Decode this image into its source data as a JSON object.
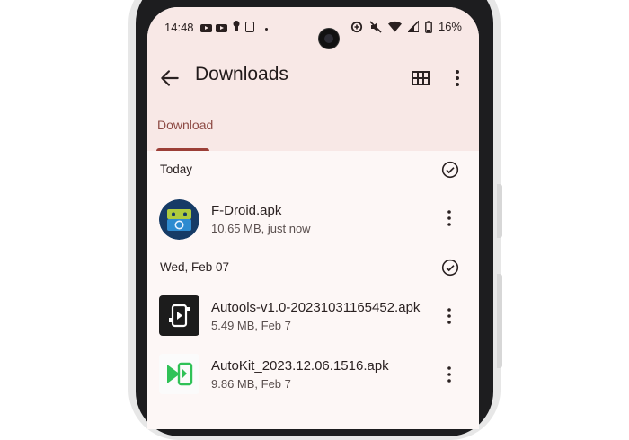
{
  "status_bar": {
    "time": "14:48",
    "battery": "16%"
  },
  "app_bar": {
    "title": "Downloads"
  },
  "tabs": [
    {
      "label": "Download",
      "selected": true
    }
  ],
  "colors": {
    "accent": "#9c3f37",
    "header_bg": "#f8e8e6",
    "list_bg": "#fdf7f6"
  },
  "sections": [
    {
      "header": "Today",
      "items": [
        {
          "name": "F-Droid.apk",
          "meta": "10.65 MB, just now",
          "icon": "fdroid-app-icon"
        }
      ]
    },
    {
      "header": "Wed, Feb 07",
      "items": [
        {
          "name": "Autools-v1.0-20231031165452.apk",
          "meta": "5.49 MB, Feb 7",
          "icon": "autools-app-icon"
        },
        {
          "name": "AutoKit_2023.12.06.1516.apk",
          "meta": "9.86 MB, Feb 7",
          "icon": "autokit-app-icon"
        }
      ]
    }
  ]
}
